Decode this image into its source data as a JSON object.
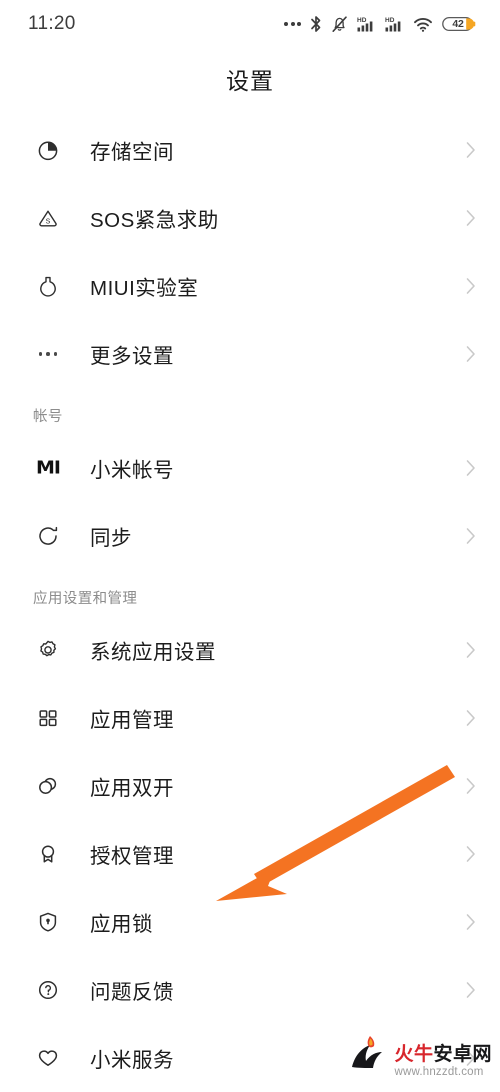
{
  "status_bar": {
    "time": "11:20",
    "battery_percent": "42",
    "icons": [
      "more-dots-icon",
      "bluetooth-icon",
      "mute-bell-icon",
      "hd-signal-icon",
      "hd-signal-icon",
      "wifi-icon",
      "battery-icon"
    ]
  },
  "header": {
    "title": "设置"
  },
  "colors": {
    "accent_orange": "#f47322",
    "chevron_gray": "#c9c9c9",
    "section_gray": "#8c8c8c",
    "battery_orange": "#f5a623",
    "watermark_red": "#d8262c"
  },
  "list": [
    {
      "type": "item",
      "icon": "storage-pie-icon",
      "label": "存储空间"
    },
    {
      "type": "item",
      "icon": "sos-triangle-icon",
      "label": "SOS紧急求助"
    },
    {
      "type": "item",
      "icon": "flask-icon",
      "label": "MIUI实验室"
    },
    {
      "type": "item",
      "icon": "more-ellipsis-icon",
      "label": "更多设置"
    },
    {
      "type": "section",
      "label": "帐号"
    },
    {
      "type": "item",
      "icon": "mi-logo-icon",
      "label": "小米帐号"
    },
    {
      "type": "item",
      "icon": "sync-icon",
      "label": "同步"
    },
    {
      "type": "section",
      "label": "应用设置和管理"
    },
    {
      "type": "item",
      "icon": "gear-icon",
      "label": "系统应用设置"
    },
    {
      "type": "item",
      "icon": "grid-apps-icon",
      "label": "应用管理"
    },
    {
      "type": "item",
      "icon": "dual-circles-icon",
      "label": "应用双开"
    },
    {
      "type": "item",
      "icon": "medal-icon",
      "label": "授权管理"
    },
    {
      "type": "item",
      "icon": "shield-lock-icon",
      "label": "应用锁"
    },
    {
      "type": "item",
      "icon": "question-circle-icon",
      "label": "问题反馈"
    },
    {
      "type": "item",
      "icon": "heart-icon",
      "label": "小米服务"
    }
  ],
  "annotation": {
    "arrow_color": "#f47322",
    "points_to": "应用锁"
  },
  "watermark": {
    "title_red": "火牛",
    "title_black": "安卓网",
    "url": "www.hnzzdt.com"
  }
}
